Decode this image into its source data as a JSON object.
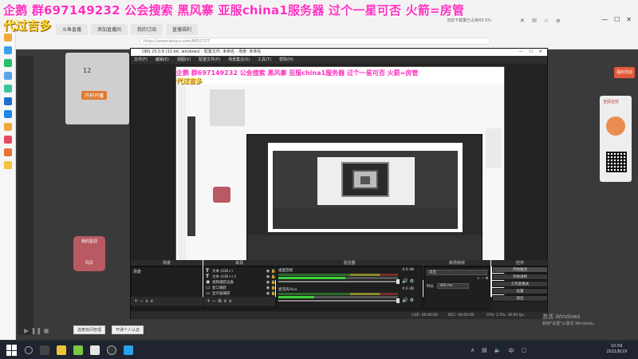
{
  "banner": {
    "line1": "企鹅 群697149232 公会搜索 黑风寨 亚服china1服务器 过个一星可否 火箭=房管",
    "line2": "代过吉多"
  },
  "browser": {
    "tabs": [
      "斗鱼直播",
      "添加直播间",
      "我的订阅",
      "直播福利"
    ],
    "address": "https://www.douyu.com/6651727",
    "notice": "当前下载量已占用43.5%",
    "window_controls": [
      "—",
      "☐",
      "✕"
    ]
  },
  "page": {
    "profile_count": "12",
    "profile_button": "开杆开播",
    "mascot_title": "我的星闻",
    "mascot_counter": "0/2",
    "right_card_label": "全民狂欢",
    "right_red": "福利活动",
    "bottom_buttons": [
      "连麦房间管理",
      "开通个人认证"
    ],
    "bottom_ctrls": "▶ ❚❚  ◼"
  },
  "obs": {
    "title": "OBS 25.0.8 (32-bit, windows) - 配置文件: 未命名 - 场景: 未命名",
    "menu": [
      "文件(F)",
      "编辑(E)",
      "视图(V)",
      "配置文件(P)",
      "场景集合(S)",
      "工具(T)",
      "帮助(H)"
    ],
    "docks": {
      "scenes_header": "场景",
      "sources_header": "来源",
      "mixer_header": "混音器",
      "transitions_header": "转场特效",
      "controls_header": "控件"
    },
    "scenes": [
      "场景"
    ],
    "sources": [
      {
        "icon": "T",
        "label": "文本 (GDI+)"
      },
      {
        "icon": "T",
        "label": "文本 (GDI+) 2"
      },
      {
        "icon": "◉",
        "label": "视频捕获设备"
      },
      {
        "icon": "▭",
        "label": "窗口捕获"
      },
      {
        "icon": "▭",
        "label": "显示器捕获"
      },
      {
        "icon": "▭",
        "label": "图像"
      }
    ],
    "mixer": [
      {
        "name": "桌面音频",
        "db": "0.0 dB"
      },
      {
        "name": "麦克风/Aux",
        "db": "0.0 dB"
      }
    ],
    "transitions": {
      "selected": "淡出",
      "duration_label": "时长",
      "duration_value": "300 ms"
    },
    "controls": [
      "开始推流",
      "开始录制",
      "工作室模式",
      "设置",
      "退出"
    ],
    "status": {
      "live": "LIVE: 00:00:00",
      "rec": "REC: 00:00:00",
      "cpu": "CPU: 2.5%, 30.00 fps"
    },
    "tools": "+ − ∧ ∨"
  },
  "activate": {
    "title": "激活 Windows",
    "subtitle": "转到\"设置\"以激活 Windows。"
  },
  "taskbar": {
    "time": "10:59",
    "date": "2021/8/19"
  },
  "colors": {
    "banner_pink": "#ff2fbf",
    "banner_yellow": "#ffdd33",
    "obs_dark": "#222222"
  }
}
